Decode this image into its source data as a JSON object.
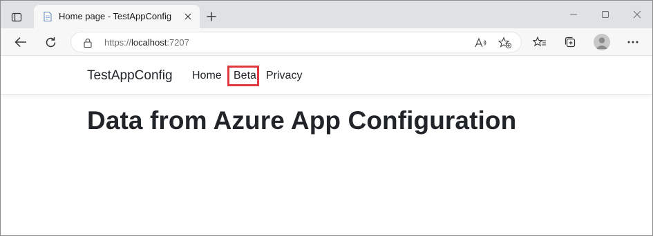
{
  "browser": {
    "tab": {
      "title": "Home page - TestAppConfig",
      "favicon": "page-icon"
    },
    "address": {
      "scheme": "https://",
      "host": "localhost",
      "port": ":7207"
    },
    "icons": {
      "tab_actions": "tab-actions-icon",
      "close_tab": "close-icon",
      "new_tab": "plus-icon",
      "minimize": "minimize-icon",
      "maximize": "maximize-icon",
      "close_window": "close-icon",
      "back": "back-arrow-icon",
      "refresh": "refresh-icon",
      "lock": "lock-icon",
      "read_aloud": "read-aloud-icon",
      "add_favorite": "add-favorite-icon",
      "favorites": "favorites-icon",
      "collections": "collections-icon",
      "profile": "profile-avatar-icon",
      "more": "more-icon"
    }
  },
  "page": {
    "brand": "TestAppConfig",
    "nav": [
      {
        "label": "Home"
      },
      {
        "label": "Beta",
        "highlighted": true
      },
      {
        "label": "Privacy"
      }
    ],
    "heading": "Data from Azure App Configuration"
  },
  "colors": {
    "highlight_border": "#e0383e",
    "text": "#212529",
    "tabstrip_bg": "#dfe2e5"
  }
}
